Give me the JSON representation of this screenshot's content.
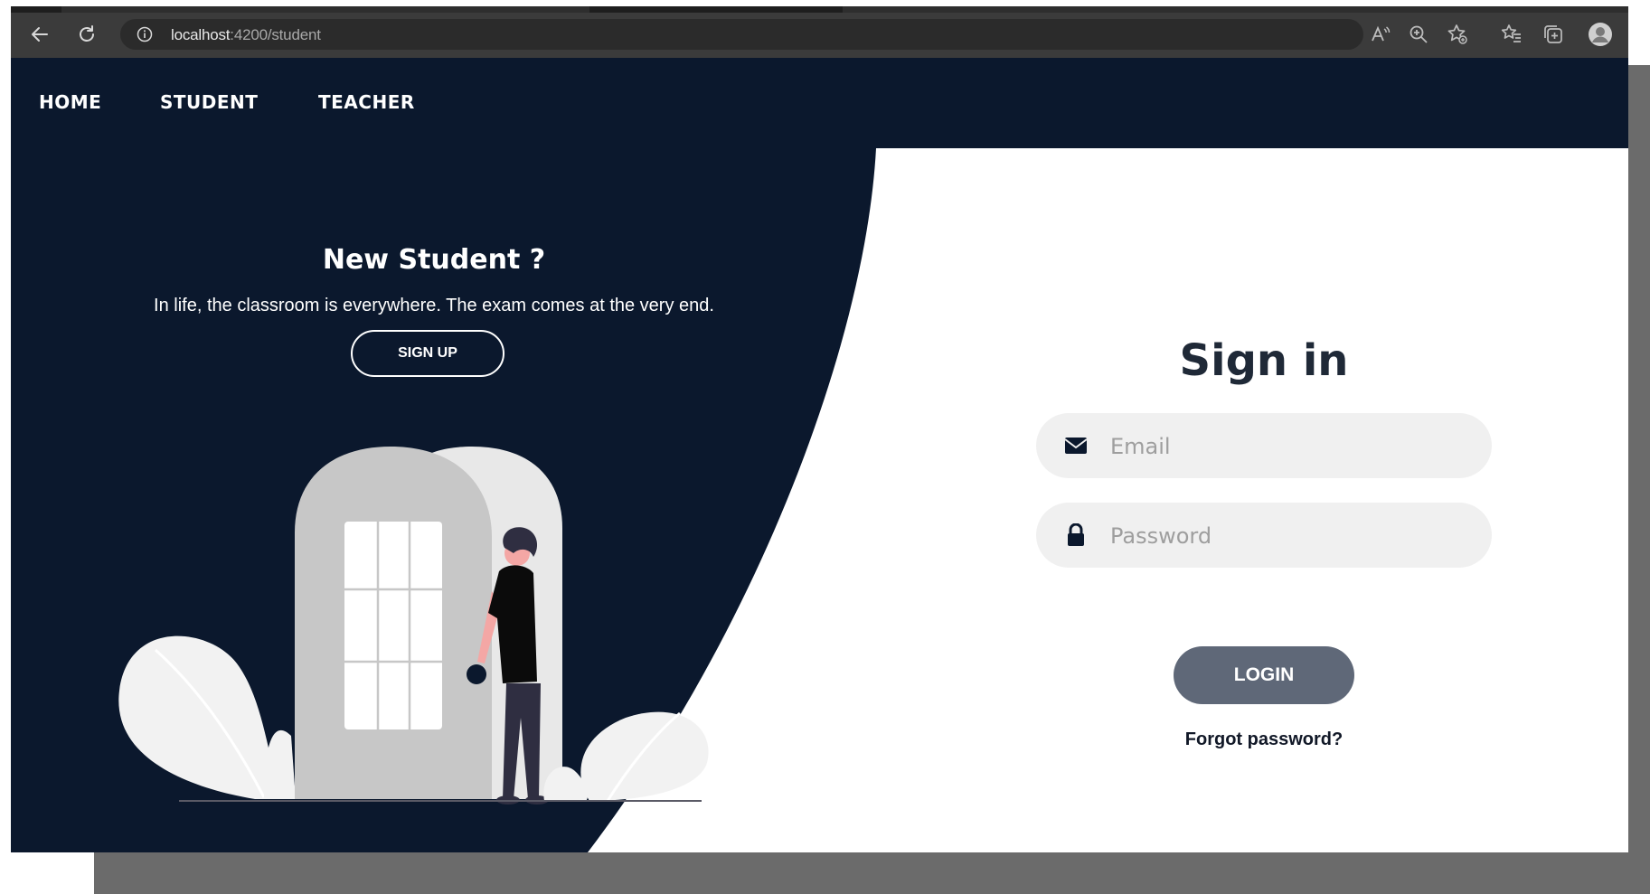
{
  "browser": {
    "url_host": "localhost",
    "url_path": ":4200/student"
  },
  "nav": {
    "items": [
      {
        "label": "HOME"
      },
      {
        "label": "STUDENT"
      },
      {
        "label": "TEACHER"
      }
    ]
  },
  "promo": {
    "title": "New Student ?",
    "subtitle": "In life, the classroom is everywhere. The exam comes at the very end.",
    "signup_label": "SIGN UP"
  },
  "signin": {
    "title": "Sign in",
    "email_placeholder": "Email",
    "password_placeholder": "Password",
    "login_label": "LOGIN",
    "forgot_label": "Forgot password?"
  },
  "colors": {
    "navy": "#0b182d",
    "button_gray": "#5f6878",
    "input_bg": "#f0f0f0"
  }
}
